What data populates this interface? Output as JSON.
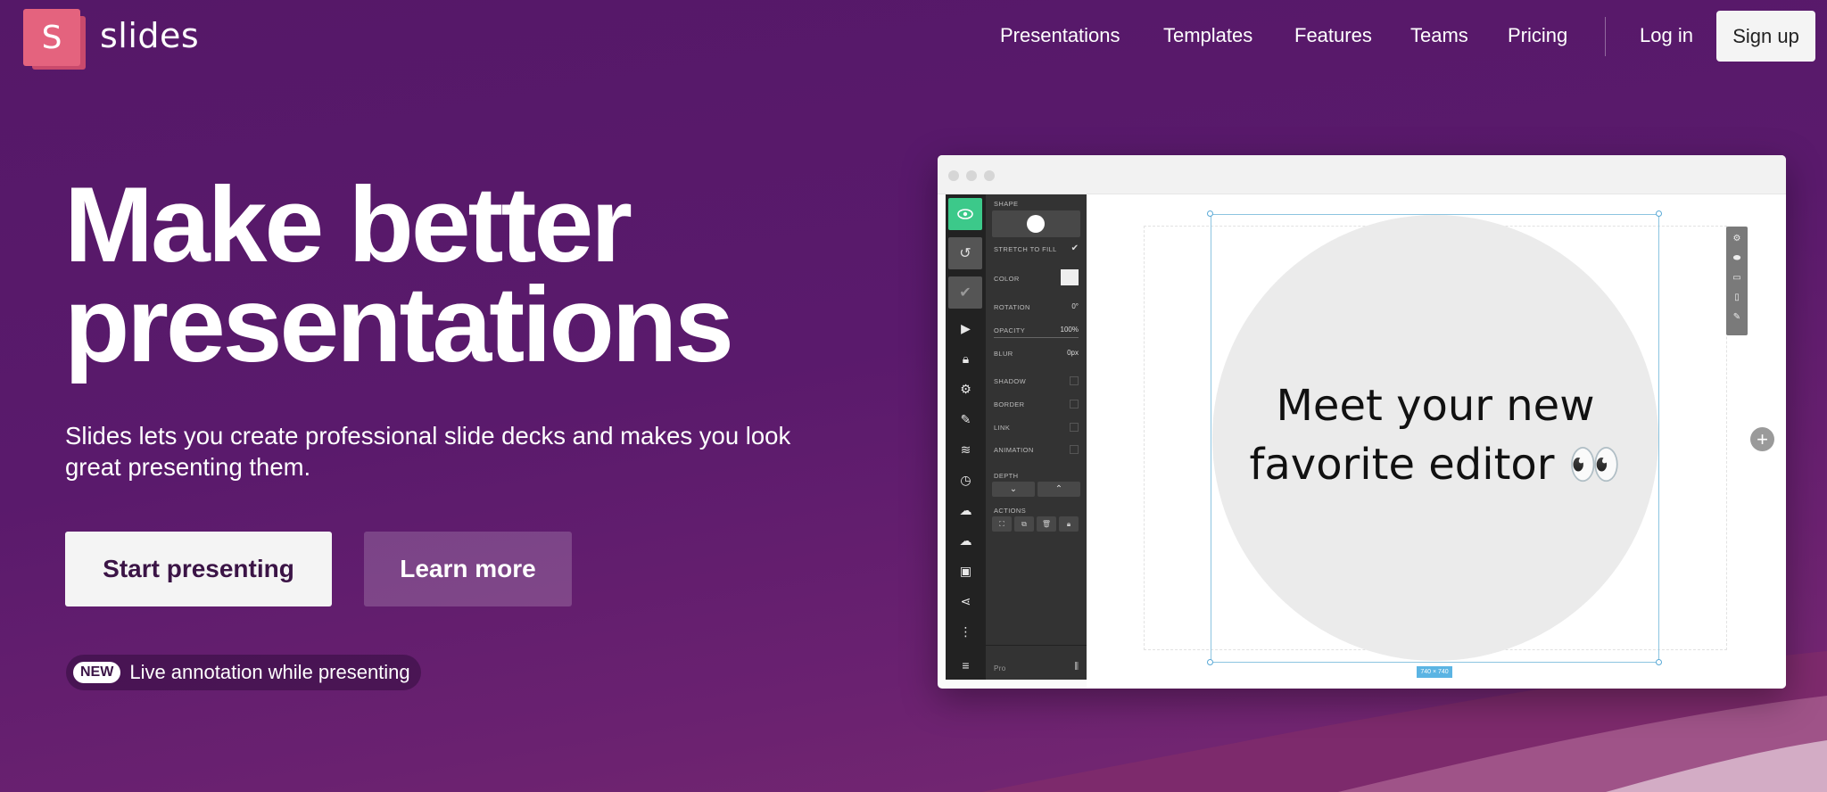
{
  "brand": {
    "logo_letter": "S",
    "name": "slides",
    "accent": "#e4637e",
    "background": "#5a1a6c"
  },
  "nav": {
    "links": [
      "Presentations",
      "Templates",
      "Features",
      "Teams",
      "Pricing"
    ],
    "login": "Log in",
    "signup": "Sign up"
  },
  "hero": {
    "title_line1": "Make better",
    "title_line2": "presentations",
    "subtitle_line1": "Slides lets you create professional slide decks and makes you look",
    "subtitle_line2": "great presenting them.",
    "primary_cta": "Start presenting",
    "secondary_cta": "Learn more",
    "news_badge": "NEW",
    "news_text": "Live annotation while presenting"
  },
  "editor": {
    "panel": {
      "shape_label": "SHAPE",
      "stretch_label": "STRETCH TO FILL",
      "color_label": "COLOR",
      "rotation_label": "ROTATION",
      "rotation_value": "0°",
      "opacity_label": "OPACITY",
      "opacity_value": "100%",
      "blur_label": "BLUR",
      "blur_value": "0px",
      "shadow_label": "SHADOW",
      "border_label": "BORDER",
      "link_label": "LINK",
      "animation_label": "ANIMATION",
      "depth_label": "DEPTH",
      "actions_label": "ACTIONS",
      "pro_label": "Pro"
    },
    "slide_text_line1": "Meet your new",
    "slide_text_line2": "favorite editor 👀",
    "dimensions": "740 × 740"
  }
}
